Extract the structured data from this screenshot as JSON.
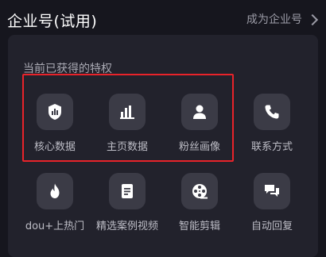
{
  "header": {
    "title": "企业号(试用)",
    "become_link": "成为企业号"
  },
  "section": {
    "title": "当前已获得的特权"
  },
  "features": [
    {
      "label": "核心数据",
      "icon": "data-shield-icon"
    },
    {
      "label": "主页数据",
      "icon": "bar-chart-icon"
    },
    {
      "label": "粉丝画像",
      "icon": "person-icon"
    },
    {
      "label": "联系方式",
      "icon": "phone-icon"
    },
    {
      "label": "dou+上热门",
      "icon": "flame-icon"
    },
    {
      "label": "精选案例视频",
      "icon": "document-icon"
    },
    {
      "label": "智能剪辑",
      "icon": "film-reel-icon"
    },
    {
      "label": "自动回复",
      "icon": "chat-bubbles-icon"
    }
  ],
  "colors": {
    "background": "#16161e",
    "card": "#22222c",
    "tile": "#3b3b46",
    "highlight": "#e8232a"
  }
}
